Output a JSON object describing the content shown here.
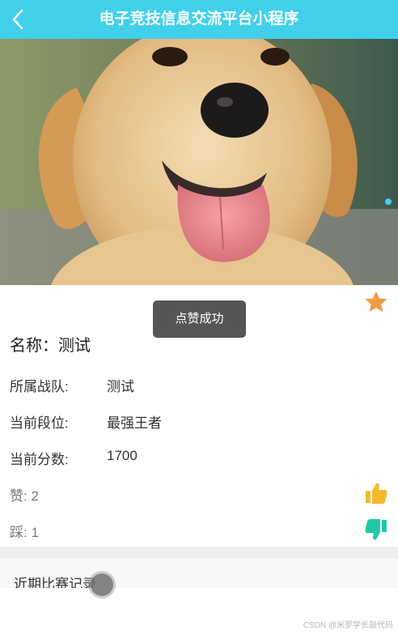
{
  "header": {
    "back_icon": "chevron-left-icon",
    "title": "电子竞技信息交流平台小程序",
    "background_color": "#41d0ea"
  },
  "banner": {
    "image": "labrador-dog-photo",
    "indicator_color": "#41d0ea"
  },
  "toast": {
    "message": "点赞成功"
  },
  "favorite": {
    "icon": "star-icon",
    "color": "#f09a42"
  },
  "detail": {
    "name_label": "名称：",
    "name_value": "测试",
    "rows": [
      {
        "label": "所属战队:",
        "value": "测试"
      },
      {
        "label": "当前段位:",
        "value": "最强王者"
      },
      {
        "label": "当前分数:",
        "value": "1700"
      }
    ]
  },
  "stats": {
    "like_label": "赞:",
    "like_count": "2",
    "like_icon": "thumbs-up-icon",
    "like_color": "#f5b92a",
    "dislike_label": "踩:",
    "dislike_count": "1",
    "dislike_icon": "thumbs-down-icon",
    "dislike_color": "#1fc8a8"
  },
  "records": {
    "title": "近期比赛记录"
  },
  "watermark": "CSDN @米罗学长敲代码"
}
